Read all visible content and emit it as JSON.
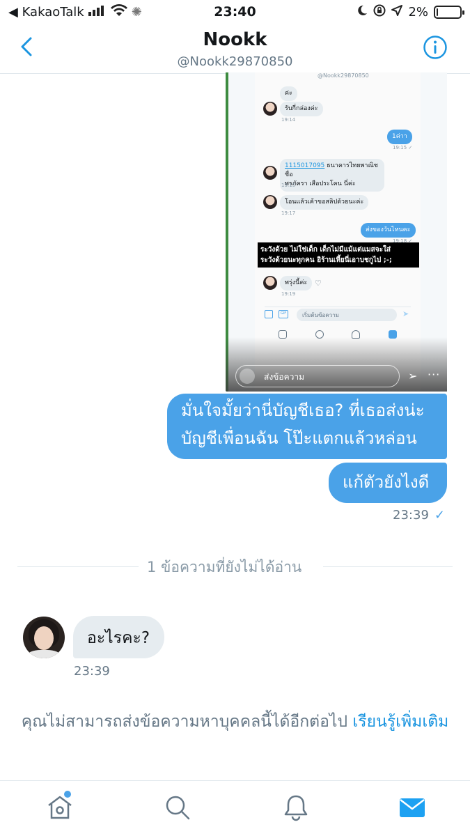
{
  "status_bar": {
    "back_app": "◀ KakaoTalk",
    "time": "23:40",
    "battery": "2%",
    "battery_fraction": 0.02
  },
  "header": {
    "title": "Nookk",
    "handle": "@Nookk29870850"
  },
  "shared_image": {
    "handle": "@Nookk29870850",
    "messages": [
      {
        "text": "ค่ะ"
      },
      {
        "text": "รับกี่กล่องค่ะ"
      },
      {
        "time": "19:14"
      },
      {
        "text": "1ค่าา"
      },
      {
        "time": "19:15 ✓"
      },
      {
        "link": "1115017095",
        "text": " ธนาคารไทยพาณิช ชื่อ",
        "text2": "พรภัครา เสือประโคน นี่ค่ะ"
      },
      {
        "time": "19:15"
      },
      {
        "text": "โอนแล้วเค้าขอสลิปด้วยนะค่ะ"
      },
      {
        "time": "19:17"
      },
      {
        "text": "ส่งของวันไหนคะ"
      },
      {
        "time": "19:18 ✓"
      },
      {
        "text": "พรุ่งนี้ค่ะ"
      },
      {
        "time": "19:19"
      }
    ],
    "warning_line1": "ระวังด้วย ไม่ใช่เด็ก เด็กไม่มีแม้แต่แมสจะใส่",
    "warning_line2": "ระวังด้วยนะทุกคน อิร้านเหี้ยนี่เอาบชกูไป ;-;",
    "compose_placeholder": "เริ่มต้นข้อความ",
    "story_placeholder": "ส่งข้อความ"
  },
  "outgoing": {
    "message1_line1": "มั่นใจมั้ยว่านี่บัญชีเธอ?  ที่เธอส่งน่ะ",
    "message1_line2": "บัญชีเพื่อนฉัน  โป๊ะแตกแล้วหล่อน",
    "message2": "แก้ตัวยังไงดี",
    "time": "23:39",
    "check": "✓"
  },
  "unread_separator": "1 ข้อความที่ยังไม่ได้อ่าน",
  "incoming": {
    "message": "อะไรคะ?",
    "time": "23:39"
  },
  "notice": {
    "text": "คุณไม่สามารถส่งข้อความหาบุคคลนี้ได้อีกต่อไป",
    "link": "เรียนรู้เพิ่มเติม"
  },
  "tabbar": {
    "items": [
      "home-icon",
      "search-icon",
      "notifications-icon",
      "messages-icon"
    ],
    "active": "messages-icon",
    "accent": "#1da1f2"
  },
  "colors": {
    "bubble_out": "#4aa2e8",
    "bubble_in": "#e6ecf0",
    "link": "#1b95e0"
  }
}
